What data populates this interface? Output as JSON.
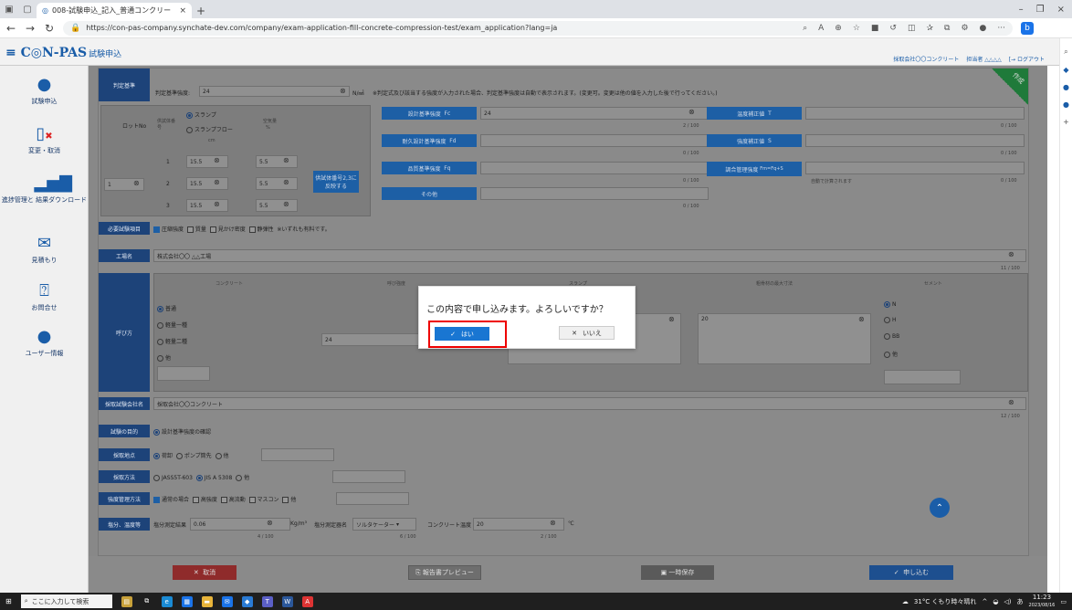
{
  "browser": {
    "tab_title": "008-試験申込_記入_普通コンクリー",
    "url": "https://con-pas-company.synchate-dev.com/company/exam-application-fill-concrete-compression-test/exam_application?lang=ja"
  },
  "header": {
    "logo": "C◎N-PAS",
    "subtitle": "試験申込",
    "company": "採取会社〇〇コンクリート",
    "person": "担当者 △△△△",
    "logout": "ログアウト"
  },
  "sidebar": {
    "items": [
      {
        "label": "試験申込"
      },
      {
        "label": "変更・取消"
      },
      {
        "label": "進捗管理と 結果ダウンロード"
      },
      {
        "label": "見積もり"
      },
      {
        "label": "お問合せ"
      },
      {
        "label": "ユーザー情報"
      }
    ]
  },
  "form": {
    "ribbon": "作成",
    "judgement_label": "判定基準",
    "judgement_strength_label": "判定基準強度:",
    "judgement_strength_value": "24",
    "unit_nmm2": "N/㎟",
    "judgement_note": "※判定式及び該当する強度が入力された場合、判定基準強度は自動で表示されます。(変更可。変更は他の値を入力した後で行ってください。)",
    "lot_label": "ロットNo",
    "specimen_label": "供試体番号",
    "slump_radio": "スランプ",
    "slumpflow_radio": "スランプフロー",
    "cm": "cm",
    "air_label": "空気量",
    "percent": "%",
    "lot_value": "1",
    "rows": [
      {
        "no": "1",
        "slump": "15.5",
        "air": "5.5"
      },
      {
        "no": "2",
        "slump": "15.5",
        "air": "5.5"
      },
      {
        "no": "3",
        "slump": "15.5",
        "air": "5.5"
      }
    ],
    "reflect_button": "供試体番号2,3に反映する",
    "design_strength_label": "設計基準強度",
    "fc": "Fc",
    "design_strength_value": "24",
    "count_100": "0 / 100",
    "count_2_100": "2 / 100",
    "durability_label": "耐久設計基準強度",
    "fd": "Fd",
    "quality_label": "品質基準強度",
    "fq": "Fq",
    "other_label": "その他",
    "temp_correction_label": "温度補正値",
    "t": "T",
    "strength_correction_label": "強度補正値",
    "s": "S",
    "mix_strength_label": "調合管理強度",
    "fm_formula": "Fm=Fq+S",
    "auto_calc_note": "自動で計算されます",
    "required_tests_label": "必要試験項目",
    "test_compression": "圧縮強度",
    "test_mass": "質量",
    "test_density": "見かけ密度",
    "test_static": "静弾性",
    "tests_note": "※いずれも有料です。",
    "site_label": "工場名",
    "site_value": "株式会社〇〇 △△工場",
    "count_11_100": "11 / 100",
    "designation_label": "呼び方",
    "concrete_col": "コンクリート",
    "strength_col": "呼び強度",
    "slump_col": "スランプ",
    "agg_col": "粗骨材の最大寸法",
    "cement_col": "セメント",
    "concrete_types": [
      "普通",
      "軽量一種",
      "軽量二種",
      "他"
    ],
    "strength_value": "24",
    "agg_value": "20",
    "cement_types": [
      "N",
      "H",
      "BB",
      "他"
    ],
    "sampling_company_label": "採取試験会社名",
    "sampling_company_value": "採取会社〇〇コンクリート",
    "count_12_100": "12 / 100",
    "purpose_label": "試験の目的",
    "purpose_value": "設計基準強度の確認",
    "place_label": "採取地点",
    "place_options": [
      "荷卸",
      "ポンプ筒先",
      "他"
    ],
    "method_label": "採取方法",
    "method_options": [
      "JASS5T-603",
      "JIS A 5308",
      "他"
    ],
    "control_label": "強度管理方法",
    "control_options": [
      "通常の場合",
      "高強度",
      "高流動",
      "マスコン",
      "他"
    ],
    "chloride_label": "塩分、温度等",
    "chloride_text": "塩分測定結果",
    "chloride_value": "0.06",
    "chloride_unit": "Kg/m³",
    "meter_label": "塩分測定器名",
    "meter_value": "ソルタケーター",
    "temp_label": "コンクリート温度",
    "temp_value": "20",
    "temp_unit": "℃",
    "count_4_100": "4 / 100",
    "count_6_100": "6 / 100"
  },
  "buttons": {
    "cancel": "取消",
    "preview": "報告書プレビュー",
    "save": "一時保存",
    "apply": "申し込む"
  },
  "dialog": {
    "message": "この内容で申し込みます。よろしいですか？",
    "yes": "はい",
    "no": "いいえ"
  },
  "taskbar": {
    "search_placeholder": "ここに入力して検索",
    "weather": "31°C くもり時々晴れ",
    "time": "11:23",
    "date": "2023/08/16"
  }
}
